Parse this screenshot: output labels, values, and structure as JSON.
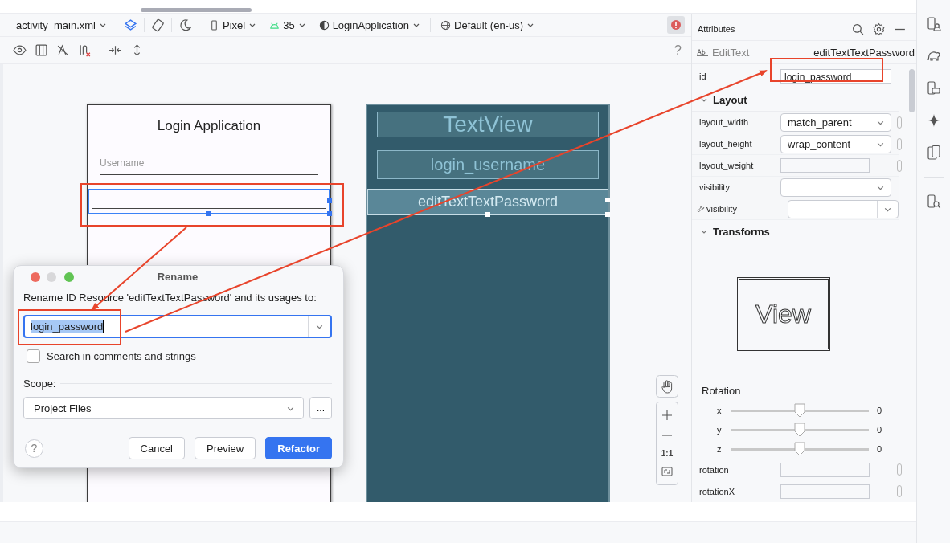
{
  "editor_toolbar": {
    "file": "activity_main.xml",
    "device": "Pixel",
    "api": "35",
    "theme": "LoginApplication",
    "locale": "Default (en-us)",
    "help": "?"
  },
  "design_preview": {
    "title": "Login Application",
    "fields": [
      {
        "kind": "text",
        "placeholder": "Username",
        "selected": false
      },
      {
        "kind": "password",
        "selected": true
      }
    ]
  },
  "blueprint": {
    "items": [
      {
        "kind": "title",
        "label": "TextView",
        "selected": false
      },
      {
        "kind": "field",
        "label": "login_username",
        "selected": false
      },
      {
        "kind": "field",
        "label": "editTextTextPassword",
        "selected": true
      }
    ]
  },
  "rename_dialog": {
    "title": "Rename",
    "prompt": "Rename ID Resource 'editTextTextPassword' and its usages to:",
    "value": "login_password",
    "search_option": {
      "label": "Search in comments and strings",
      "checked": false
    },
    "scope_label": "Scope:",
    "scope": "Project Files",
    "more": "...",
    "help": "?",
    "buttons": [
      {
        "label": "Cancel",
        "primary": false
      },
      {
        "label": "Preview",
        "primary": false
      },
      {
        "label": "Refactor",
        "primary": true
      }
    ]
  },
  "zoom_controls": {
    "actual_size": "1:1"
  },
  "attributes": {
    "title": "Attributes",
    "widget_type": "EditText",
    "widget_id": "editTextTextPassword",
    "id_label": "id",
    "id_value": "login_password",
    "layout": {
      "title": "Layout",
      "expanded": true,
      "rows": [
        {
          "label": "layout_width",
          "kind": "dropdown",
          "value": "match_parent",
          "tools": false,
          "picker": true
        },
        {
          "label": "layout_height",
          "kind": "dropdown",
          "value": "wrap_content",
          "tools": false,
          "picker": true
        },
        {
          "label": "layout_weight",
          "kind": "text",
          "tools": false,
          "picker": true
        },
        {
          "label": "visibility",
          "kind": "dropdown",
          "tools": false,
          "picker": false
        },
        {
          "label": "visibility",
          "kind": "dropdown",
          "tools": true,
          "picker": false
        }
      ]
    },
    "transforms": {
      "title": "Transforms",
      "expanded": true,
      "preview": "View",
      "rotation_title": "Rotation",
      "axes": [
        {
          "label": "x",
          "level": 0.5,
          "reading": "0"
        },
        {
          "label": "y",
          "level": 0.5,
          "reading": "0"
        },
        {
          "label": "z",
          "level": 0.5,
          "reading": "0"
        }
      ],
      "rows": [
        {
          "label": "rotation"
        },
        {
          "label": "rotationX"
        }
      ]
    }
  }
}
